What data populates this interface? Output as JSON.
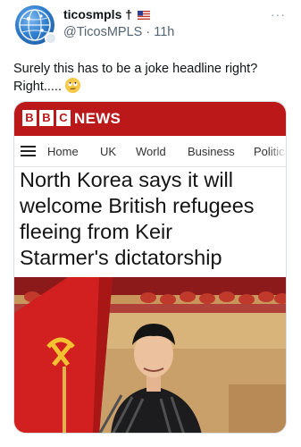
{
  "tweet": {
    "display_name": "ticosmpls †",
    "handle": "@TicosMPLS",
    "separator": "·",
    "time": "11h",
    "more": "···",
    "text_line1": "Surely this has to be a joke headline right?",
    "text_line2": "Right.....",
    "emoji": "rolling-eyes-emoji"
  },
  "card": {
    "brand_letters": [
      "B",
      "B",
      "C"
    ],
    "brand_news": "NEWS",
    "brand_color": "#bb1919",
    "nav": [
      "Home",
      "UK",
      "World",
      "Business",
      "Politic"
    ],
    "headline_lines": [
      "North Korea says it will",
      "welcome British refugees",
      "fleeing from Keir",
      "Starmer's dictatorship"
    ]
  },
  "colors": {
    "text": "#0f1419",
    "secondary": "#536471",
    "flag_icon": "us-flag-icon"
  }
}
